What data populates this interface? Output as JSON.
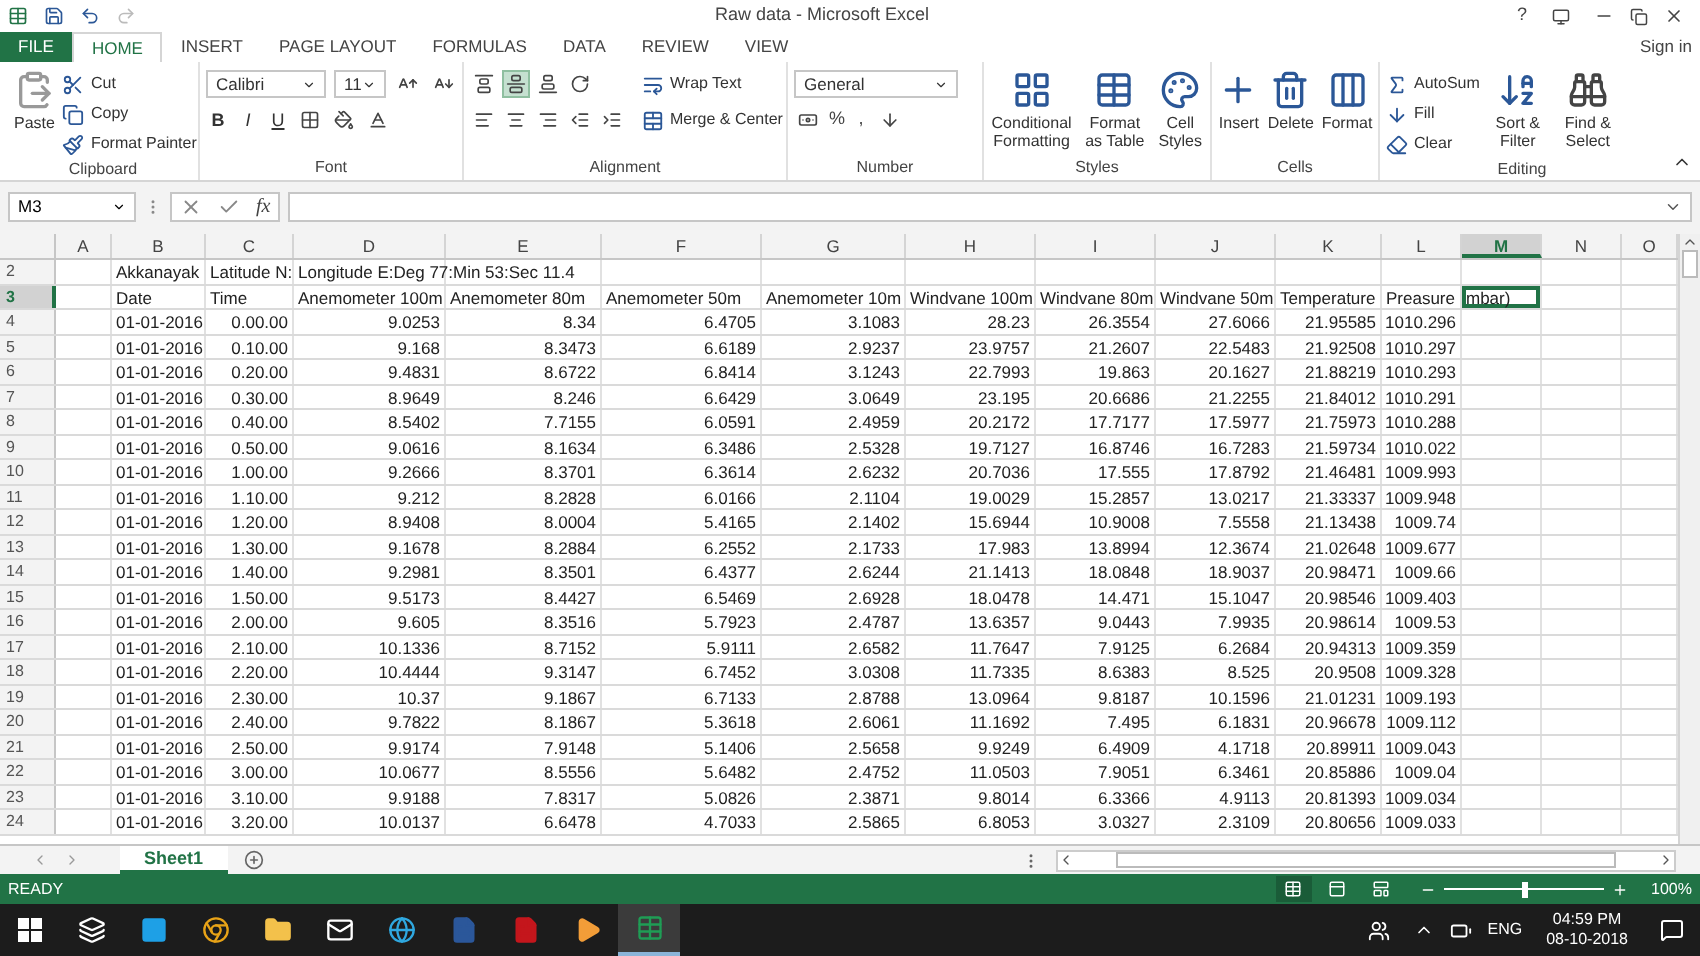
{
  "title_bar": {
    "title": "Raw data - Microsoft Excel",
    "help": "?"
  },
  "ribbon_tabs": [
    {
      "label": "FILE",
      "kind": "file",
      "selected": false
    },
    {
      "label": "HOME",
      "kind": "tab",
      "selected": true
    },
    {
      "label": "INSERT",
      "kind": "tab",
      "selected": false
    },
    {
      "label": "PAGE LAYOUT",
      "kind": "tab",
      "selected": false
    },
    {
      "label": "FORMULAS",
      "kind": "tab",
      "selected": false
    },
    {
      "label": "DATA",
      "kind": "tab",
      "selected": false
    },
    {
      "label": "REVIEW",
      "kind": "tab",
      "selected": false
    },
    {
      "label": "VIEW",
      "kind": "tab",
      "selected": false
    }
  ],
  "sign_in": "Sign in",
  "clipboard": {
    "paste": "Paste",
    "cut": "Cut",
    "copy": "Copy",
    "format_painter": "Format Painter",
    "label": "Clipboard"
  },
  "font": {
    "name": "Calibri",
    "size": "11",
    "style_buttons": [
      "B",
      "I",
      "U"
    ],
    "label": "Font"
  },
  "alignment": {
    "align_buttons": [
      {
        "kind": "top",
        "selected": false
      },
      {
        "kind": "middle",
        "selected": true
      },
      {
        "kind": "bottom",
        "selected": false
      }
    ],
    "wrap_text": "Wrap Text",
    "merge_center": "Merge & Center",
    "label": "Alignment"
  },
  "number": {
    "format": "General",
    "symbols": [
      "%",
      ","
    ],
    "label": "Number"
  },
  "styles": {
    "buttons": [
      "Conditional Formatting",
      "Format as Table",
      "Cell Styles"
    ],
    "label": "Styles"
  },
  "cells": {
    "buttons": [
      "Insert",
      "Delete",
      "Format"
    ],
    "label": "Cells"
  },
  "editing": {
    "autosum": "AutoSum",
    "fill": "Fill",
    "clear": "Clear",
    "sort": "Sort & Filter",
    "find": "Find & Select",
    "label": "Editing"
  },
  "formula_bar": {
    "name_box": "M3",
    "fx": "fx"
  },
  "grid": {
    "columns": [
      {
        "label": "A",
        "selected": false
      },
      {
        "label": "B",
        "selected": false
      },
      {
        "label": "C",
        "selected": false
      },
      {
        "label": "D",
        "selected": false
      },
      {
        "label": "E",
        "selected": false
      },
      {
        "label": "F",
        "selected": false
      },
      {
        "label": "G",
        "selected": false
      },
      {
        "label": "H",
        "selected": false
      },
      {
        "label": "I",
        "selected": false
      },
      {
        "label": "J",
        "selected": false
      },
      {
        "label": "K",
        "selected": false
      },
      {
        "label": "L",
        "selected": false
      },
      {
        "label": "M",
        "selected": true
      },
      {
        "label": "N",
        "selected": false
      },
      {
        "label": "O",
        "selected": false
      }
    ],
    "rows": [
      {
        "number": "2",
        "kind": "info",
        "selected": false,
        "cells": [
          "",
          "Akkanayak",
          "Latitude N:",
          "Longitude E:Deg 77:Min 53:Sec 11.4"
        ]
      },
      {
        "number": "3",
        "kind": "header",
        "selected": true,
        "cells": [
          "",
          "Date",
          "Time",
          "Anemometer 100m",
          "Anemometer 80m",
          "Anemometer 50m",
          "Anemometer 10m",
          "Windvane 100m",
          "Windvane 80m",
          "Windvane 50m",
          "Temperature",
          "Preasure",
          "mbar)"
        ]
      },
      {
        "number": "4",
        "kind": "data",
        "selected": false,
        "cells": [
          "",
          "01-01-2016",
          "0.00.00",
          "9.0253",
          "8.34",
          "6.4705",
          "3.1083",
          "28.23",
          "26.3554",
          "27.6066",
          "21.95585",
          "1010.296"
        ]
      },
      {
        "number": "5",
        "kind": "data",
        "selected": false,
        "cells": [
          "",
          "01-01-2016",
          "0.10.00",
          "9.168",
          "8.3473",
          "6.6189",
          "2.9237",
          "23.9757",
          "21.2607",
          "22.5483",
          "21.92508",
          "1010.297"
        ]
      },
      {
        "number": "6",
        "kind": "data",
        "selected": false,
        "cells": [
          "",
          "01-01-2016",
          "0.20.00",
          "9.4831",
          "8.6722",
          "6.8414",
          "3.1243",
          "22.7993",
          "19.863",
          "20.1627",
          "21.88219",
          "1010.293"
        ]
      },
      {
        "number": "7",
        "kind": "data",
        "selected": false,
        "cells": [
          "",
          "01-01-2016",
          "0.30.00",
          "8.9649",
          "8.246",
          "6.6429",
          "3.0649",
          "23.195",
          "20.6686",
          "21.2255",
          "21.84012",
          "1010.291"
        ]
      },
      {
        "number": "8",
        "kind": "data",
        "selected": false,
        "cells": [
          "",
          "01-01-2016",
          "0.40.00",
          "8.5402",
          "7.7155",
          "6.0591",
          "2.4959",
          "20.2172",
          "17.7177",
          "17.5977",
          "21.75973",
          "1010.288"
        ]
      },
      {
        "number": "9",
        "kind": "data",
        "selected": false,
        "cells": [
          "",
          "01-01-2016",
          "0.50.00",
          "9.0616",
          "8.1634",
          "6.3486",
          "2.5328",
          "19.7127",
          "16.8746",
          "16.7283",
          "21.59734",
          "1010.022"
        ]
      },
      {
        "number": "10",
        "kind": "data",
        "selected": false,
        "cells": [
          "",
          "01-01-2016",
          "1.00.00",
          "9.2666",
          "8.3701",
          "6.3614",
          "2.6232",
          "20.7036",
          "17.555",
          "17.8792",
          "21.46481",
          "1009.993"
        ]
      },
      {
        "number": "11",
        "kind": "data",
        "selected": false,
        "cells": [
          "",
          "01-01-2016",
          "1.10.00",
          "9.212",
          "8.2828",
          "6.0166",
          "2.1104",
          "19.0029",
          "15.2857",
          "13.0217",
          "21.33337",
          "1009.948"
        ]
      },
      {
        "number": "12",
        "kind": "data",
        "selected": false,
        "cells": [
          "",
          "01-01-2016",
          "1.20.00",
          "8.9408",
          "8.0004",
          "5.4165",
          "2.1402",
          "15.6944",
          "10.9008",
          "7.5558",
          "21.13438",
          "1009.74"
        ]
      },
      {
        "number": "13",
        "kind": "data",
        "selected": false,
        "cells": [
          "",
          "01-01-2016",
          "1.30.00",
          "9.1678",
          "8.2884",
          "6.2552",
          "2.1733",
          "17.983",
          "13.8994",
          "12.3674",
          "21.02648",
          "1009.677"
        ]
      },
      {
        "number": "14",
        "kind": "data",
        "selected": false,
        "cells": [
          "",
          "01-01-2016",
          "1.40.00",
          "9.2981",
          "8.3501",
          "6.4377",
          "2.6244",
          "21.1413",
          "18.0848",
          "18.9037",
          "20.98471",
          "1009.66"
        ]
      },
      {
        "number": "15",
        "kind": "data",
        "selected": false,
        "cells": [
          "",
          "01-01-2016",
          "1.50.00",
          "9.5173",
          "8.4427",
          "6.5469",
          "2.6928",
          "18.0478",
          "14.471",
          "15.1047",
          "20.98546",
          "1009.403"
        ]
      },
      {
        "number": "16",
        "kind": "data",
        "selected": false,
        "cells": [
          "",
          "01-01-2016",
          "2.00.00",
          "9.605",
          "8.3516",
          "5.7923",
          "2.4787",
          "13.6357",
          "9.0443",
          "7.9935",
          "20.98614",
          "1009.53"
        ]
      },
      {
        "number": "17",
        "kind": "data",
        "selected": false,
        "cells": [
          "",
          "01-01-2016",
          "2.10.00",
          "10.1336",
          "8.7152",
          "5.9111",
          "2.6582",
          "11.7647",
          "7.9125",
          "6.2684",
          "20.94313",
          "1009.359"
        ]
      },
      {
        "number": "18",
        "kind": "data",
        "selected": false,
        "cells": [
          "",
          "01-01-2016",
          "2.20.00",
          "10.4444",
          "9.3147",
          "6.7452",
          "3.0308",
          "11.7335",
          "8.6383",
          "8.525",
          "20.9508",
          "1009.328"
        ]
      },
      {
        "number": "19",
        "kind": "data",
        "selected": false,
        "cells": [
          "",
          "01-01-2016",
          "2.30.00",
          "10.37",
          "9.1867",
          "6.7133",
          "2.8788",
          "13.0964",
          "9.8187",
          "10.1596",
          "21.01231",
          "1009.193"
        ]
      },
      {
        "number": "20",
        "kind": "data",
        "selected": false,
        "cells": [
          "",
          "01-01-2016",
          "2.40.00",
          "9.7822",
          "8.1867",
          "5.3618",
          "2.6061",
          "11.1692",
          "7.495",
          "6.1831",
          "20.96678",
          "1009.112"
        ]
      },
      {
        "number": "21",
        "kind": "data",
        "selected": false,
        "cells": [
          "",
          "01-01-2016",
          "2.50.00",
          "9.9174",
          "7.9148",
          "5.1406",
          "2.5658",
          "9.9249",
          "6.4909",
          "4.1718",
          "20.89911",
          "1009.043"
        ]
      },
      {
        "number": "22",
        "kind": "data",
        "selected": false,
        "cells": [
          "",
          "01-01-2016",
          "3.00.00",
          "10.0677",
          "8.5556",
          "5.6482",
          "2.4752",
          "11.0503",
          "7.9051",
          "6.3461",
          "20.85886",
          "1009.04"
        ]
      },
      {
        "number": "23",
        "kind": "data",
        "selected": false,
        "cells": [
          "",
          "01-01-2016",
          "3.10.00",
          "9.9188",
          "7.8317",
          "5.0826",
          "2.3871",
          "9.8014",
          "6.3366",
          "4.9113",
          "20.81393",
          "1009.034"
        ]
      },
      {
        "number": "24",
        "kind": "data",
        "selected": false,
        "cells": [
          "",
          "01-01-2016",
          "3.20.00",
          "10.0137",
          "6.6478",
          "4.7033",
          "2.5865",
          "6.8053",
          "3.0327",
          "2.3109",
          "20.80656",
          "1009.033"
        ]
      }
    ]
  },
  "sheet_tabs": [
    {
      "label": "Sheet1",
      "selected": true
    }
  ],
  "status_bar": {
    "status": "READY",
    "views": [
      {
        "kind": "normal",
        "selected": true
      },
      {
        "kind": "layout",
        "selected": false
      },
      {
        "kind": "break",
        "selected": false
      }
    ],
    "zoom": {
      "level": 0.5
    },
    "zoom_text": "100%"
  },
  "taskbar": {
    "apps": [
      {
        "kind": "taskview",
        "active": false
      },
      {
        "kind": "launcher",
        "active": false
      },
      {
        "kind": "chrome",
        "active": false
      },
      {
        "kind": "folder",
        "active": false
      },
      {
        "kind": "mail",
        "active": false
      },
      {
        "kind": "browser",
        "active": false
      },
      {
        "kind": "word",
        "active": false
      },
      {
        "kind": "pdf",
        "active": false
      },
      {
        "kind": "media",
        "active": false
      },
      {
        "kind": "excel",
        "active": true
      }
    ],
    "language": "ENG",
    "time": "04:59 PM",
    "date": "08-10-2018"
  }
}
